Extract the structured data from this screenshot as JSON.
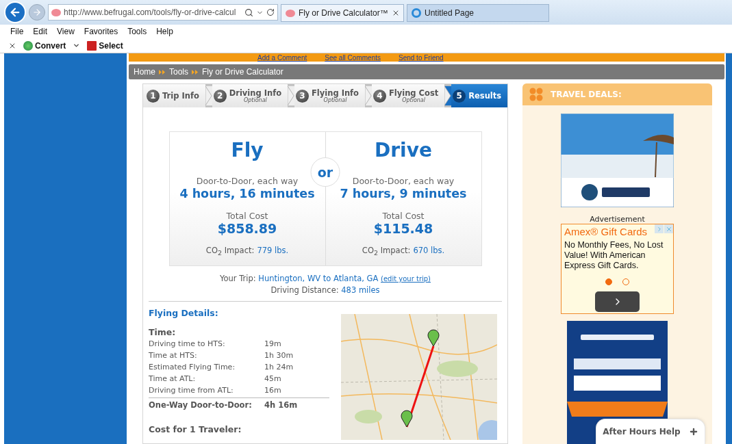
{
  "browser": {
    "address": "http://www.befrugal.com/tools/fly-or-drive-calcul",
    "tabs": [
      {
        "title": "Fly or Drive Calculator™",
        "selected": true
      },
      {
        "title": "Untitled Page",
        "selected": false
      }
    ],
    "menu": [
      "File",
      "Edit",
      "View",
      "Favorites",
      "Tools",
      "Help"
    ],
    "toolbar": [
      {
        "kind": "convert",
        "label": "Convert"
      },
      {
        "kind": "select",
        "label": "Select"
      }
    ]
  },
  "page": {
    "top_links": [
      "Add a Comment",
      "See all Comments",
      "Send to Friend"
    ],
    "breadcrumb": [
      "Home",
      "Tools",
      "Fly or Drive Calculator"
    ],
    "steps": [
      {
        "number": "1",
        "label": "Trip Info",
        "selected": false
      },
      {
        "number": "2",
        "label": "Driving Info",
        "note": "Optional",
        "selected": false
      },
      {
        "number": "3",
        "label": "Flying Info",
        "note": "Optional",
        "selected": false
      },
      {
        "number": "4",
        "label": "Flying Cost",
        "note": "Optional",
        "selected": false
      },
      {
        "number": "5",
        "label": "Results",
        "selected": true
      }
    ],
    "results": {
      "separator": "or",
      "options": [
        {
          "title": "Fly",
          "subtitle": "Door-to-Door, each way",
          "duration": "4 hours, 16 minutes",
          "cost_label": "Total Cost",
          "cost": "$858.89",
          "co2_label": "CO$_{2}$ Impact:",
          "co2": "779 lbs."
        },
        {
          "title": "Drive",
          "subtitle": "Door-to-Door, each way",
          "duration": "7 hours, 9 minutes",
          "cost_label": "Total Cost",
          "cost": "$115.48",
          "co2_label": "CO$_{2}$ Impact:",
          "co2": "670 lbs."
        }
      ]
    },
    "trip": {
      "label": "Your Trip:",
      "route": "Huntington, WV to Atlanta, GA",
      "edit_link": "(edit your trip)",
      "distance_label": "Driving Distance:",
      "distance": "483 miles"
    },
    "flying_details": {
      "title": "Flying Details:",
      "time_heading": "Time:",
      "rows": [
        {
          "label": "Driving time to HTS:",
          "value": "19m"
        },
        {
          "label": "Time at HTS:",
          "value": "1h 30m"
        },
        {
          "label": "Estimated Flying Time:",
          "value": "1h 24m"
        },
        {
          "label": "Time at ATL:",
          "value": "45m"
        },
        {
          "label": "Driving time from ATL:",
          "value": "16m"
        }
      ],
      "total": {
        "label": "One-Way Door-to-Door:",
        "value": "4h 16m"
      },
      "cost_heading": "Cost for 1 Traveler:"
    }
  },
  "sidebar": {
    "title": "TRAVEL DEALS:",
    "ad_label": "Advertisement",
    "text_ad": {
      "title": "Amex® Gift Cards",
      "body": "No Monthly Fees, No Lost Value! With American Express Gift Cards.",
      "pages": [
        {
          "selected": true
        },
        {
          "selected": false
        }
      ]
    }
  },
  "help_tab": {
    "label": "After Hours Help"
  }
}
